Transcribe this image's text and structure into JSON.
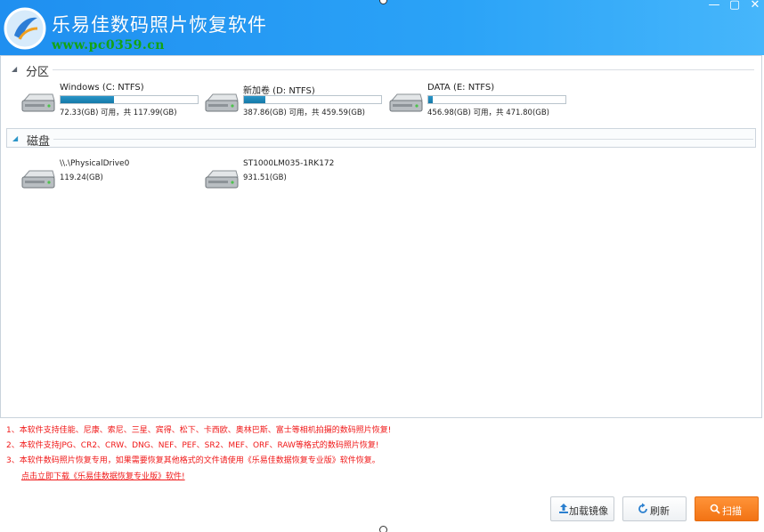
{
  "window": {
    "title": "乐易佳数码照片恢复软件",
    "watermark": "www.pc0359.cn",
    "controls": {
      "minimize": "—",
      "maximize": "▢",
      "close": "✕"
    }
  },
  "sections": {
    "partitions": {
      "label": "分区"
    },
    "disks": {
      "label": "磁盘"
    }
  },
  "partitions": [
    {
      "name": "Windows (C: NTFS)",
      "size_text": "72.33(GB) 可用，共 117.99(GB)",
      "used_fraction": 0.387
    },
    {
      "name": "新加卷 (D: NTFS)",
      "size_text": "387.86(GB) 可用，共 459.59(GB)",
      "used_fraction": 0.156
    },
    {
      "name": "DATA (E: NTFS)",
      "size_text": "456.98(GB) 可用，共 471.80(GB)",
      "used_fraction": 0.031
    }
  ],
  "disks": [
    {
      "name": "\\\\.\\PhysicalDrive0",
      "size_text": "119.24(GB)"
    },
    {
      "name": "ST1000LM035-1RK172",
      "size_text": "931.51(GB)"
    }
  ],
  "notes": [
    "1、本软件支持佳能、尼康、索尼、三星、宾得、松下、卡西欧、奥林巴斯、富士等相机拍摄的数码照片恢复!",
    "2、本软件支持JPG、CR2、CRW、DNG、NEF、PEF、SR2、MEF、ORF、RAW等格式的数码照片恢复!",
    "3、本软件数码照片恢复专用，如果需要恢复其他格式的文件请使用《乐易佳数据恢复专业版》软件恢复。"
  ],
  "download_link": "点击立即下载《乐易佳数据恢复专业版》软件!",
  "buttons": {
    "load_image": "加载镜像",
    "refresh": "刷新",
    "scan": "扫描"
  },
  "colors": {
    "title_bar": "#2196f3",
    "accent": "#f5821f",
    "note_text": "#f01818",
    "watermark": "#13a313"
  }
}
